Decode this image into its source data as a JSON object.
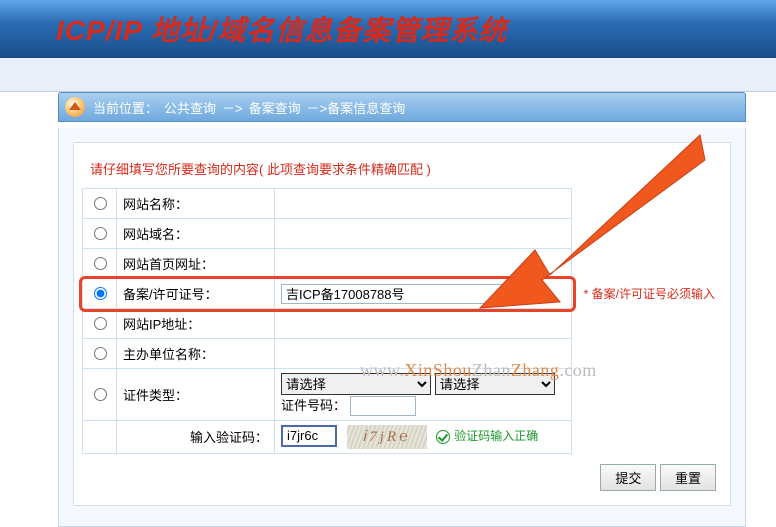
{
  "header": {
    "title": "ICP/IP 地址/域名信息备案管理系统"
  },
  "breadcrumb": {
    "label": "当前位置：",
    "l1": "公共查询",
    "sep": "－>",
    "l2": "备案查询",
    "l3": "备案信息查询"
  },
  "instruction": "请仔细填写您所要查询的内容( 此项查询要求条件精确匹配 )",
  "rows": {
    "site_name": "网站名称：",
    "site_domain": "网站域名：",
    "site_url": "网站首页网址：",
    "record_no": "备案/许可证号：",
    "site_ip": "网站IP地址：",
    "org_name": "主办单位名称：",
    "cert_type": "证件类型：",
    "captcha_label": "输入验证码："
  },
  "values": {
    "record_no": "吉ICP备17008788号",
    "captcha": "i7jr6c"
  },
  "selects": {
    "please": "请选择",
    "cert_no_label": "证件号码："
  },
  "note_record": "* 备案/许可证号必须输入",
  "captcha_chars": "ⅰ7jR℮",
  "captcha_ok": "验证码输入正确",
  "buttons": {
    "submit": "提交",
    "reset": "重置"
  },
  "watermark": {
    "p1": "www.",
    "p2": "XinShou",
    "p3": "Zhan",
    "p4": "Zhang",
    "p5": ".com"
  }
}
